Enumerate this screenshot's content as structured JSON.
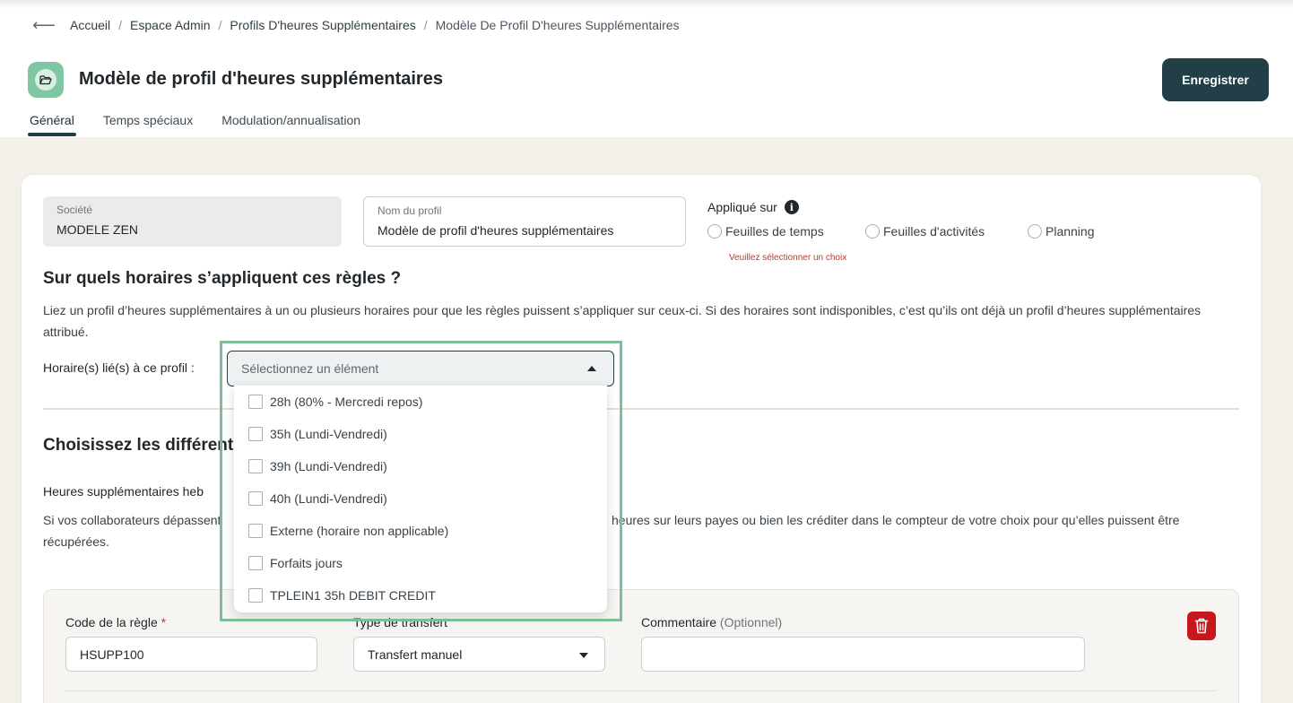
{
  "breadcrumb": {
    "items": [
      "Accueil",
      "Espace Admin",
      "Profils D'heures Supplémentaires",
      "Modèle De Profil D'heures Supplémentaires"
    ]
  },
  "header": {
    "title": "Modèle de profil d'heures supplémentaires",
    "save_label": "Enregistrer"
  },
  "tabs": [
    {
      "label": "Général",
      "active": true
    },
    {
      "label": "Temps spéciaux",
      "active": false
    },
    {
      "label": "Modulation/annualisation",
      "active": false
    }
  ],
  "form": {
    "company": {
      "label": "Société",
      "value": "MODELE ZEN"
    },
    "profile_name": {
      "label": "Nom du profil",
      "value": "Modèle de profil d'heures supplémentaires"
    },
    "applied_on": {
      "label": "Appliqué sur",
      "info": "i",
      "options": [
        "Feuilles de temps",
        "Feuilles d'activités",
        "Planning"
      ],
      "error": "Veuillez sélectionner un choix"
    }
  },
  "schedules": {
    "heading": "Sur quels horaires s’appliquent ces règles ?",
    "description": "Liez un profil d’heures supplémentaires à un ou plusieurs horaires pour que les règles puissent s’appliquer sur ceux-ci. Si des horaires sont indisponibles, c’est qu’ils ont déjà un profil d’heures supplémentaires attribué.",
    "select_label": "Horaire(s) lié(s) à ce profil :",
    "select_placeholder": "Sélectionnez un élément",
    "options": [
      "28h (80% - Mercredi repos)",
      "35h (Lundi-Vendredi)",
      "39h (Lundi-Vendredi)",
      "40h (Lundi-Vendredi)",
      "Externe (horaire non applicable)",
      "Forfaits jours",
      "TPLEIN1 35h DEBIT CREDIT"
    ]
  },
  "rules": {
    "heading_visible": "Choisissez les différente",
    "subheading_visible": "Heures supplémentaires heb",
    "desc_left_line1": "Si vos collaborateurs dépassent",
    "desc_right_line1": "heures sur leurs payes ou bien les créditer dans le compteur de votre choix pour qu’elles puissent être",
    "desc_line2": "récupérées."
  },
  "rule": {
    "code_label": "Code de la règle",
    "required_mark": "*",
    "code_value": "HSUPP100",
    "transfer_label": "Type de transfert",
    "transfer_value": "Transfert manuel",
    "comment_label": "Commentaire",
    "comment_optional": "(Optionnel)",
    "comment_value": ""
  },
  "colors": {
    "primary": "#223f47",
    "accent_green": "#7cbf97",
    "danger": "#c8161d",
    "error_text": "#c0392b"
  }
}
